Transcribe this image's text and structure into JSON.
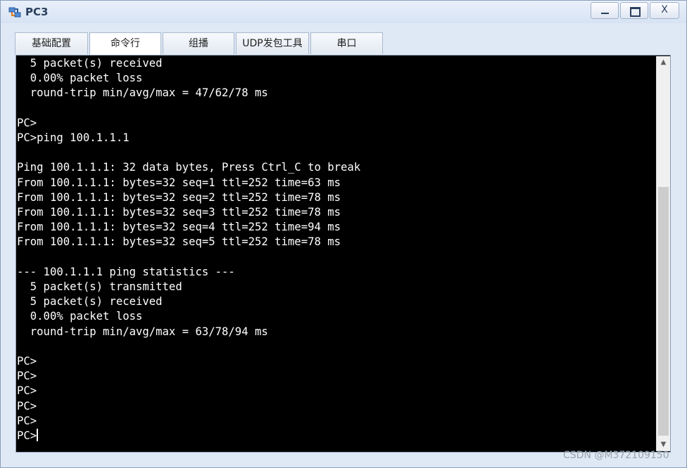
{
  "window": {
    "title": "PC3",
    "icon": "network-pc-icon",
    "controls": {
      "minimize": "minimize-icon",
      "maximize": "maximize-icon",
      "close": "X"
    }
  },
  "tabs": [
    {
      "label": "基础配置",
      "active": false
    },
    {
      "label": "命令行",
      "active": true
    },
    {
      "label": "组播",
      "active": false
    },
    {
      "label": "UDP发包工具",
      "active": false
    },
    {
      "label": "串口",
      "active": false
    }
  ],
  "terminal": {
    "lines": [
      "  5 packet(s) received",
      "  0.00% packet loss",
      "  round-trip min/avg/max = 47/62/78 ms",
      "",
      "PC>",
      "PC>ping 100.1.1.1",
      "",
      "Ping 100.1.1.1: 32 data bytes, Press Ctrl_C to break",
      "From 100.1.1.1: bytes=32 seq=1 ttl=252 time=63 ms",
      "From 100.1.1.1: bytes=32 seq=2 ttl=252 time=78 ms",
      "From 100.1.1.1: bytes=32 seq=3 ttl=252 time=78 ms",
      "From 100.1.1.1: bytes=32 seq=4 ttl=252 time=94 ms",
      "From 100.1.1.1: bytes=32 seq=5 ttl=252 time=78 ms",
      "",
      "--- 100.1.1.1 ping statistics ---",
      "  5 packet(s) transmitted",
      "  5 packet(s) received",
      "  0.00% packet loss",
      "  round-trip min/avg/max = 63/78/94 ms",
      "",
      "PC>",
      "PC>",
      "PC>",
      "PC>",
      "PC>",
      "PC>"
    ]
  },
  "watermark": "CSDN @M372109150",
  "colors": {
    "terminal_bg": "#000000",
    "terminal_fg": "#ffffff",
    "title_text": "#2a3f5e"
  }
}
